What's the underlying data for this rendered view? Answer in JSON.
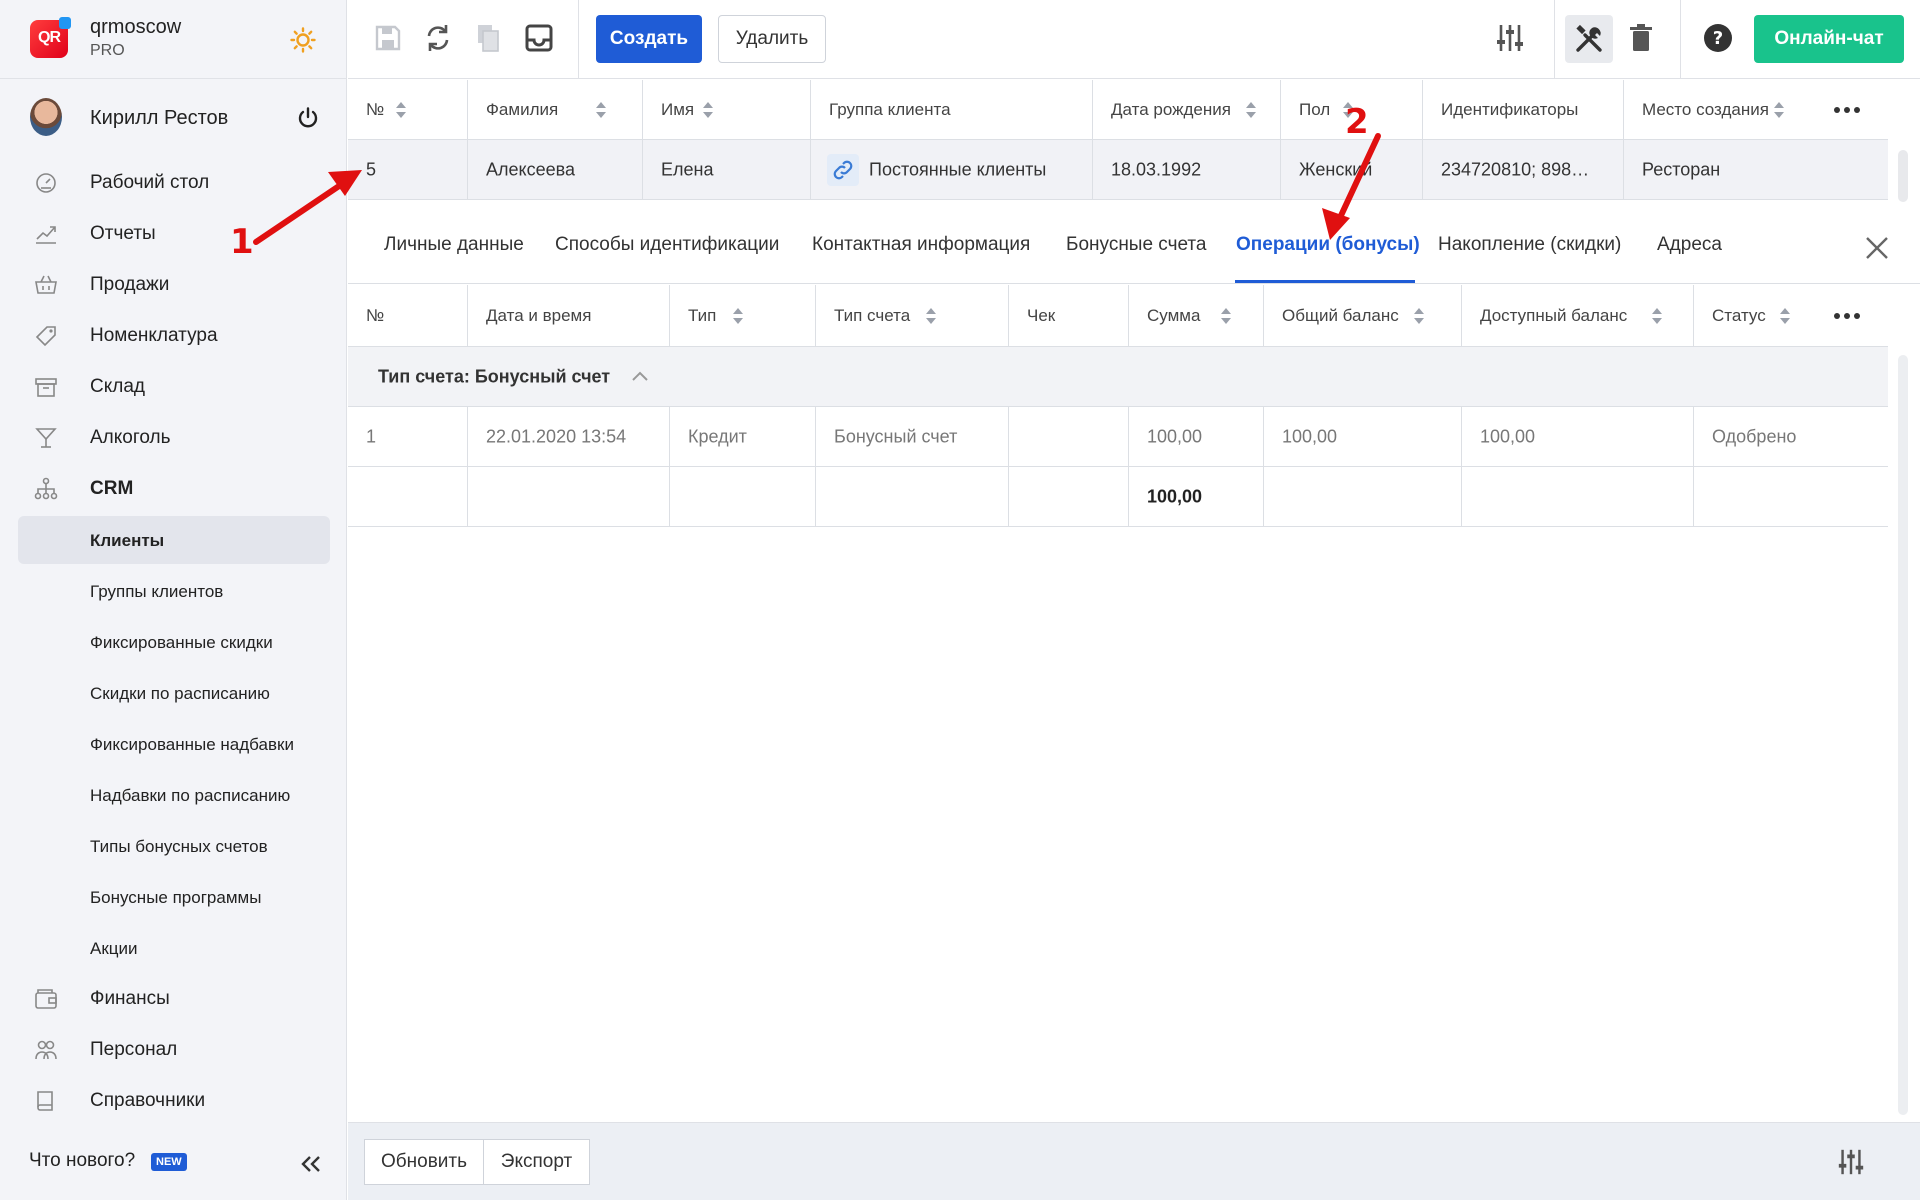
{
  "brand": {
    "name": "qrmoscow",
    "plan": "PRO",
    "logo_text": "QR"
  },
  "user": {
    "name": "Кирилл Рестов"
  },
  "nav": {
    "main_items": [
      {
        "label": "Рабочий стол",
        "icon": "dashboard-gauge-icon"
      },
      {
        "label": "Отчеты",
        "icon": "chart-trend-icon"
      },
      {
        "label": "Продажи",
        "icon": "basket-icon"
      },
      {
        "label": "Номенклатура",
        "icon": "tag-icon"
      },
      {
        "label": "Склад",
        "icon": "archive-box-icon"
      },
      {
        "label": "Алкоголь",
        "icon": "cocktail-glass-icon"
      },
      {
        "label": "CRM",
        "icon": "hierarchy-icon"
      }
    ],
    "crm_sub_items": [
      {
        "label": "Клиенты"
      },
      {
        "label": "Группы клиентов"
      },
      {
        "label": "Фиксированные скидки"
      },
      {
        "label": "Скидки по расписанию"
      },
      {
        "label": "Фиксированные надбавки"
      },
      {
        "label": "Надбавки по расписанию"
      },
      {
        "label": "Типы бонусных счетов"
      },
      {
        "label": "Бонусные программы"
      },
      {
        "label": "Акции"
      }
    ],
    "bottom_items": [
      {
        "label": "Финансы",
        "icon": "wallet-icon"
      },
      {
        "label": "Персонал",
        "icon": "people-icon"
      },
      {
        "label": "Справочники",
        "icon": "book-icon"
      }
    ],
    "whats_new": "Что нового?",
    "new_badge": "NEW"
  },
  "toolbar": {
    "create_label": "Создать",
    "delete_label": "Удалить",
    "chat_label": "Онлайн-чат"
  },
  "clients_table": {
    "headers": [
      "№",
      "Фамилия",
      "Имя",
      "Группа клиента",
      "Дата рождения",
      "Пол",
      "Идентификаторы",
      "Место создания"
    ],
    "row": [
      "5",
      "Алексеева",
      "Елена",
      "Постоянные клиенты",
      "18.03.1992",
      "Женский",
      "234720810; 898…",
      "Ресторан"
    ]
  },
  "tabs": [
    {
      "label": "Личные данные"
    },
    {
      "label": "Способы идентификации"
    },
    {
      "label": "Контактная информация"
    },
    {
      "label": "Бонусные счета"
    },
    {
      "label": "Операции (бонусы)",
      "active": true
    },
    {
      "label": "Накопление (скидки)"
    },
    {
      "label": "Адреса"
    }
  ],
  "ops_table": {
    "headers": [
      "№",
      "Дата и время",
      "Тип",
      "Тип счета",
      "Чек",
      "Сумма",
      "Общий баланс",
      "Доступный баланс",
      "Статус"
    ],
    "group_label": "Тип счета: Бонусный счет",
    "rows": [
      [
        "1",
        "22.01.2020 13:54",
        "Кредит",
        "Бонусный счет",
        "",
        "100,00",
        "100,00",
        "100,00",
        "Одобрено"
      ]
    ],
    "total": "100,00"
  },
  "bottom_bar": {
    "refresh_label": "Обновить",
    "export_label": "Экспорт"
  },
  "annotations": {
    "marker_1": "1",
    "marker_2": "2"
  },
  "colors": {
    "accent": "#1f5cd6",
    "chat": "#19c38c",
    "annotation": "#e01010"
  }
}
